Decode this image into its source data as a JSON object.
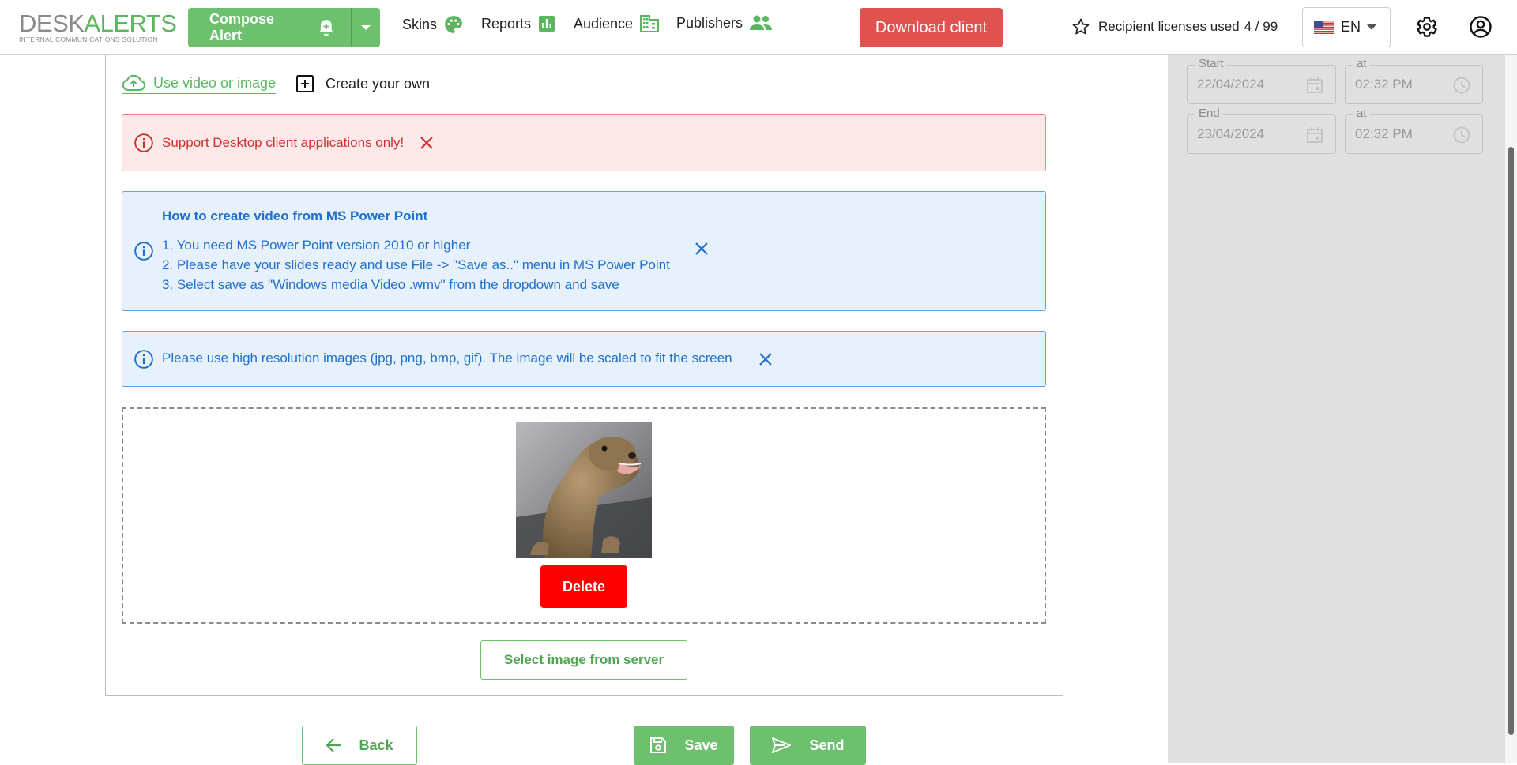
{
  "brand": {
    "name_part1": "DESK",
    "name_part2": "ALERTS",
    "tagline": "INTERNAL COMMUNICATIONS SOLUTION"
  },
  "header": {
    "compose_label": "Compose Alert",
    "nav": [
      {
        "label": "Skins",
        "icon": "palette-icon"
      },
      {
        "label": "Reports",
        "icon": "bar-chart-icon"
      },
      {
        "label": "Audience",
        "icon": "building-icon"
      },
      {
        "label": "Publishers",
        "icon": "people-icon"
      }
    ],
    "download_label": "Download client",
    "licenses_label": "Recipient licenses used",
    "licenses_value": "4 / 99",
    "language": "EN"
  },
  "tabs": {
    "video_label": "Use video or image",
    "own_label": "Create your own"
  },
  "alerts": {
    "error_text": "Support Desktop client applications only!",
    "howto_title": "How to create video from MS Power Point",
    "howto_lines": [
      "1. You need MS Power Point version 2010 or higher",
      "2. Please have your slides ready and use File -> \"Save as..\" menu in MS Power Point",
      "3. Select save as \"Windows media Video .wmv\" from the dropdown and save"
    ],
    "image_hint": "Please use high resolution images (jpg, png, bmp, gif). The image will be scaled to fit the screen"
  },
  "upload": {
    "delete_label": "Delete",
    "select_server_label": "Select image from server"
  },
  "footer": {
    "back_label": "Back",
    "save_label": "Save",
    "send_label": "Send"
  },
  "schedule": {
    "start_label": "Start",
    "start_date": "22/04/2024",
    "start_at_label": "at",
    "start_time": "02:32 PM",
    "end_label": "End",
    "end_date": "23/04/2024",
    "end_at_label": "at",
    "end_time": "02:32 PM"
  },
  "colors": {
    "brand_green": "#6cc06e",
    "danger": "#e0524f",
    "delete_red": "#ff0000",
    "info_blue": "#1f6fcf"
  }
}
